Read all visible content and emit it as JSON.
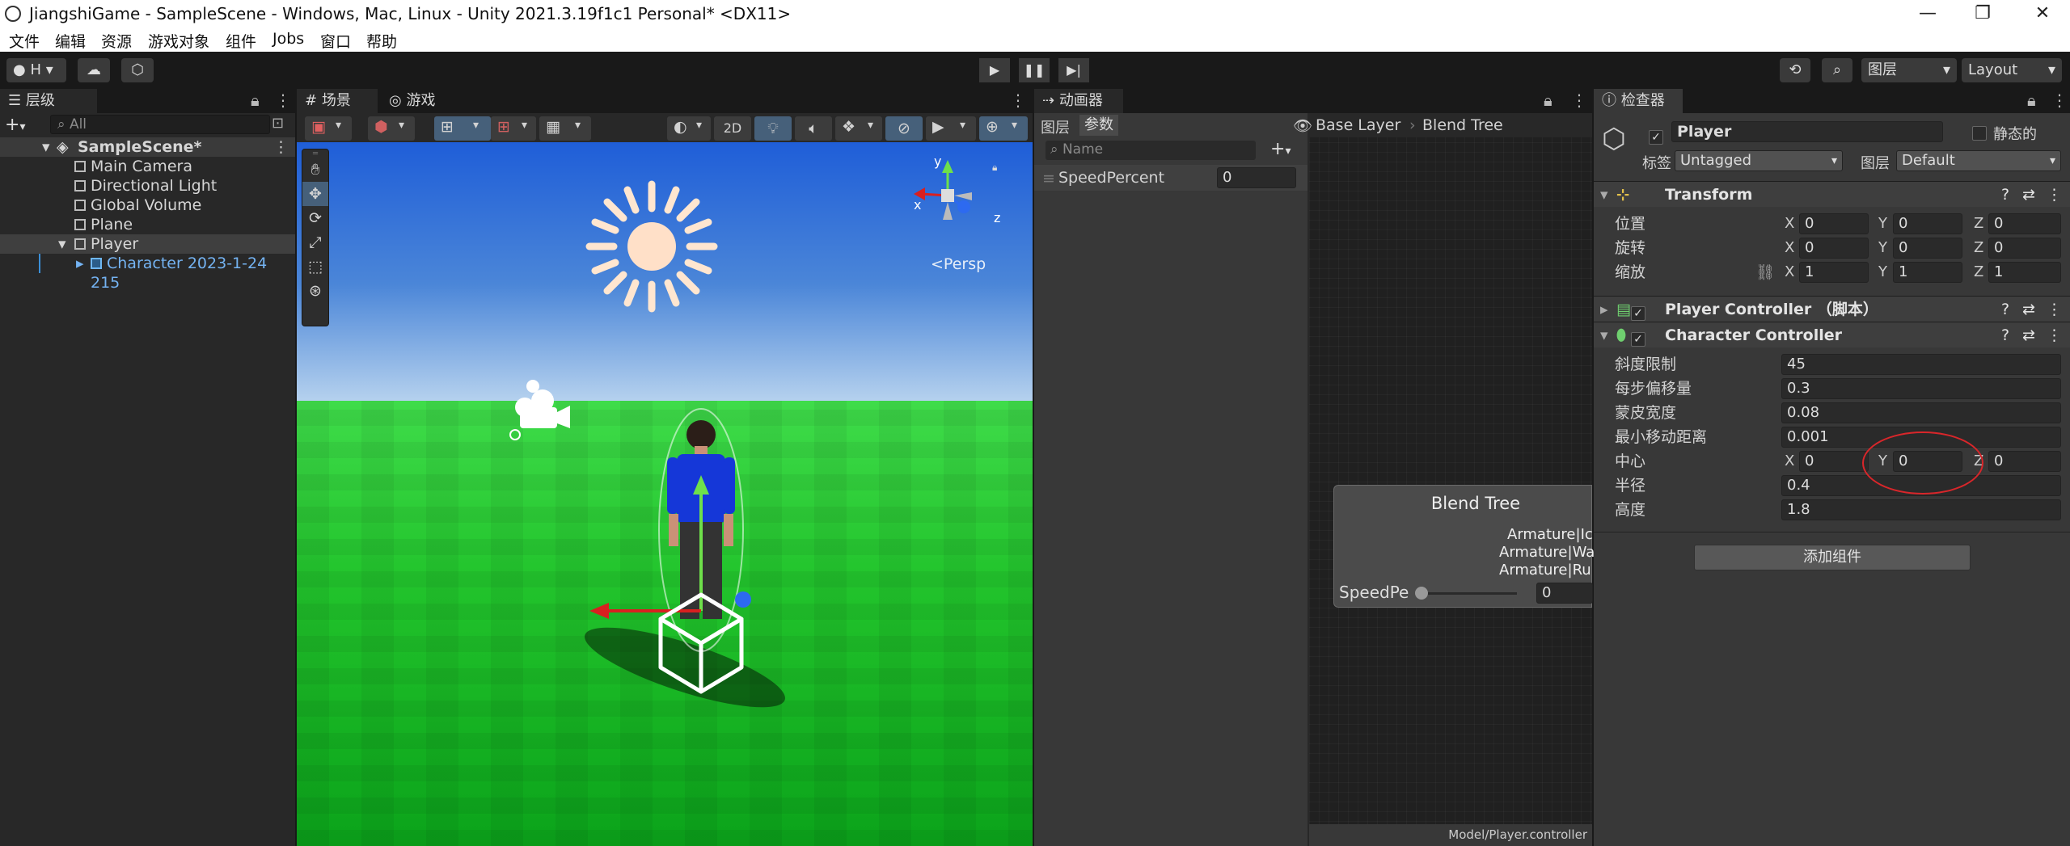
{
  "window": {
    "title": "JiangshiGame - SampleScene - Windows, Mac, Linux - Unity 2021.3.19f1c1 Personal* <DX11>",
    "minimize": "—",
    "maximize": "❐",
    "close": "✕"
  },
  "menu": [
    "文件",
    "编辑",
    "资源",
    "游戏对象",
    "组件",
    "Jobs",
    "窗口",
    "帮助"
  ],
  "toolbar": {
    "account": "H",
    "layers_label": "图层",
    "layout_label": "Layout"
  },
  "hierarchy": {
    "tab": "层级",
    "search_placeholder": "All",
    "scene": "SampleScene*",
    "items": [
      "Main Camera",
      "Directional Light",
      "Global Volume",
      "Plane",
      "Player"
    ],
    "child": "Character 2023-1-24 215"
  },
  "scene_view": {
    "tab_scene": "场景",
    "tab_game": "游戏",
    "mode_2d": "2D",
    "persp_label": "<Persp",
    "gizmo_y": "y",
    "gizmo_x": "x",
    "gizmo_z": "z"
  },
  "animator": {
    "tab": "动画器",
    "tab_layers": "图层",
    "tab_params": "参数",
    "search_placeholder": "Name",
    "param_name": "SpeedPercent",
    "param_value": "0",
    "breadcrumb_1": "Base Layer",
    "breadcrumb_2": "Blend Tree",
    "node_title": "Blend Tree",
    "node_motions": [
      "Armature|Ic",
      "Armature|Wa",
      "Armature|Ru"
    ],
    "node_param": "SpeedPe",
    "node_value": "0",
    "footer_path": "Model/Player.controller"
  },
  "inspector": {
    "tab": "检查器",
    "object_name": "Player",
    "static_label": "静态的",
    "tag_label": "标签",
    "tag_value": "Untagged",
    "layer_label": "图层",
    "layer_value": "Default",
    "transform": {
      "title": "Transform",
      "rows": [
        {
          "label": "位置",
          "x": "0",
          "y": "0",
          "z": "0"
        },
        {
          "label": "旋转",
          "x": "0",
          "y": "0",
          "z": "0"
        },
        {
          "label": "缩放",
          "x": "1",
          "y": "1",
          "z": "1"
        }
      ]
    },
    "player_controller": "Player Controller  （脚本）",
    "character_controller": {
      "title": "Character Controller",
      "slope_label": "斜度限制",
      "slope": "45",
      "step_label": "每步偏移量",
      "step": "0.3",
      "skin_label": "蒙皮宽度",
      "skin": "0.08",
      "min_move_label": "最小移动距离",
      "min_move": "0.001",
      "center_label": "中心",
      "center_x": "0",
      "center_y": "0",
      "center_z": "0",
      "radius_label": "半径",
      "radius": "0.4",
      "height_label": "高度",
      "height": "1.8"
    },
    "add_component": "添加组件"
  },
  "colors": {
    "editor_bg": "#282828",
    "inspector_bg": "#383838",
    "selection": "#2c5d87",
    "annotation_circle": "#d9262a"
  }
}
